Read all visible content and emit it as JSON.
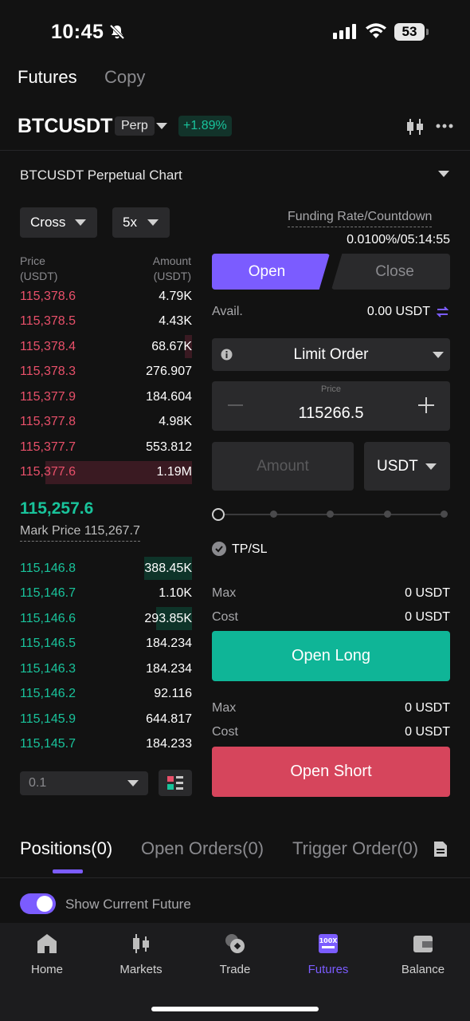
{
  "status_bar": {
    "time": "10:45",
    "battery": "53"
  },
  "top_tabs": {
    "futures": "Futures",
    "copy": "Copy"
  },
  "symbol_header": {
    "symbol": "BTCUSDT",
    "type": "Perp",
    "change": "+1.89%"
  },
  "chart_title": "BTCUSDT Perpetual Chart",
  "margin_mode": "Cross",
  "leverage": "5x",
  "orderbook": {
    "price_header": [
      "Price",
      "(USDT)"
    ],
    "amount_header": [
      "Amount",
      "(USDT)"
    ],
    "asks": [
      {
        "price": "115,378.6",
        "amount": "4.79K",
        "depth": 0.0
      },
      {
        "price": "115,378.5",
        "amount": "4.43K",
        "depth": 0.0
      },
      {
        "price": "115,378.4",
        "amount": "68.67K",
        "depth": 0.04
      },
      {
        "price": "115,378.3",
        "amount": "276.907",
        "depth": 0.0
      },
      {
        "price": "115,377.9",
        "amount": "184.604",
        "depth": 0.0
      },
      {
        "price": "115,377.8",
        "amount": "4.98K",
        "depth": 0.0
      },
      {
        "price": "115,377.7",
        "amount": "553.812",
        "depth": 0.0
      },
      {
        "price": "115,377.6",
        "amount": "1.19M",
        "depth": 0.85
      }
    ],
    "last_price": "115,257.6",
    "mark_price": "Mark Price 115,267.7",
    "bids": [
      {
        "price": "115,146.8",
        "amount": "388.45K",
        "depth": 0.28
      },
      {
        "price": "115,146.7",
        "amount": "1.10K",
        "depth": 0.0
      },
      {
        "price": "115,146.6",
        "amount": "293.85K",
        "depth": 0.21
      },
      {
        "price": "115,146.5",
        "amount": "184.234",
        "depth": 0.0
      },
      {
        "price": "115,146.3",
        "amount": "184.234",
        "depth": 0.0
      },
      {
        "price": "115,146.2",
        "amount": "92.116",
        "depth": 0.0
      },
      {
        "price": "115,145.9",
        "amount": "644.817",
        "depth": 0.0
      },
      {
        "price": "115,145.7",
        "amount": "184.233",
        "depth": 0.0
      }
    ],
    "precision": "0.1"
  },
  "trade_panel": {
    "funding_label": "Funding Rate/Countdown",
    "funding_value": "0.0100%/05:14:55",
    "open_tab": "Open",
    "close_tab": "Close",
    "avail_label": "Avail.",
    "avail_value": "0.00 USDT",
    "order_type": "Limit Order",
    "price_label": "Price",
    "price_value": "115266.5",
    "amount_placeholder": "Amount",
    "amount_unit": "USDT",
    "tpsl_label": "TP/SL",
    "long": {
      "max_label": "Max",
      "max_value": "0 USDT",
      "cost_label": "Cost",
      "cost_value": "0 USDT",
      "button": "Open Long"
    },
    "short": {
      "max_label": "Max",
      "max_value": "0 USDT",
      "cost_label": "Cost",
      "cost_value": "0 USDT",
      "button": "Open Short"
    }
  },
  "position_tabs": {
    "positions": "Positions(0)",
    "open_orders": "Open Orders(0)",
    "trigger_order": "Trigger Order(0)"
  },
  "show_current_future": "Show Current Future",
  "bottom_nav": [
    {
      "label": "Home",
      "icon": "home-icon"
    },
    {
      "label": "Markets",
      "icon": "candlestick-icon"
    },
    {
      "label": "Trade",
      "icon": "trade-icon"
    },
    {
      "label": "Futures",
      "icon": "futures-icon"
    },
    {
      "label": "Balance",
      "icon": "wallet-icon"
    }
  ],
  "colors": {
    "accent": "#7b5cff",
    "buy": "#19c39b",
    "sell": "#e9506a",
    "background": "#121212"
  }
}
